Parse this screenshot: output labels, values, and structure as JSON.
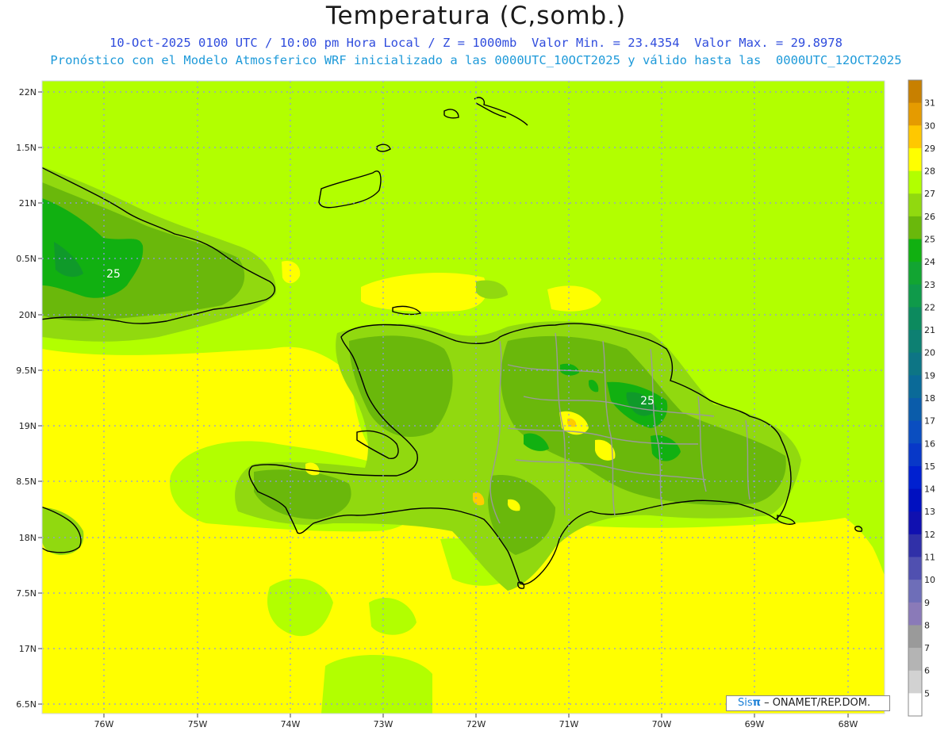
{
  "header": {
    "title": "Temperatura (C,somb.)",
    "subtitle_line1": "10-Oct-2025 0100 UTC / 10:00 pm Hora Local / Z = 1000mb  Valor Min. = 23.4354  Valor Max. = 29.8978",
    "subtitle_line2": "Pronóstico con el Modelo Atmosferico WRF inicializado a las 0000UTC_10OCT2025 y válido hasta las  0000UTC_12OCT2025"
  },
  "map": {
    "lat_labels": [
      "22N",
      "1.5N",
      "21N",
      "0.5N",
      "20N",
      "9.5N",
      "19N",
      "8.5N",
      "18N",
      "7.5N",
      "17N",
      "6.5N"
    ],
    "lon_labels": [
      "76W",
      "75W",
      "74W",
      "73W",
      "72W",
      "71W",
      "70W",
      "69W",
      "68W"
    ],
    "contour_labels": [
      "25",
      "25"
    ],
    "colors": {
      "base_28": "#b2ff00",
      "band_29": "#ffff00",
      "band_27": "#91d90f",
      "band_26": "#6ab80b",
      "band_25": "#11b011",
      "band_24": "#0f9a2a",
      "band_30": "#ffcc00",
      "band_31": "#f0a000",
      "grid_line": "#8f95e8",
      "coastline": "#000000",
      "borders": "#9a9a9a"
    }
  },
  "colorbar": {
    "labels": [
      "31",
      "30",
      "29",
      "28",
      "27",
      "26",
      "25",
      "24",
      "23",
      "22",
      "21",
      "20",
      "19",
      "18",
      "17",
      "16",
      "15",
      "14",
      "13",
      "12",
      "11",
      "10",
      "9",
      "8",
      "7",
      "6",
      "5"
    ],
    "colors": [
      "#c88000",
      "#e59b00",
      "#ffc800",
      "#ffff00",
      "#b2ff00",
      "#91d90f",
      "#6ab80b",
      "#11b011",
      "#12a532",
      "#0f9a4a",
      "#0c8a5e",
      "#0d8072",
      "#0d7585",
      "#0a6a98",
      "#0a5caa",
      "#0a4ec0",
      "#0838c8",
      "#0020d0",
      "#0010c0",
      "#1010b0",
      "#3030a8",
      "#5050b0",
      "#6e6eb8",
      "#8a7ab8",
      "#9a9a9a",
      "#b4b4b4",
      "#d2d2d2",
      "#ffffff"
    ]
  },
  "credit": {
    "brand": "Sis",
    "pi": "π",
    "rest": " – ONAMET/REP.DOM."
  }
}
